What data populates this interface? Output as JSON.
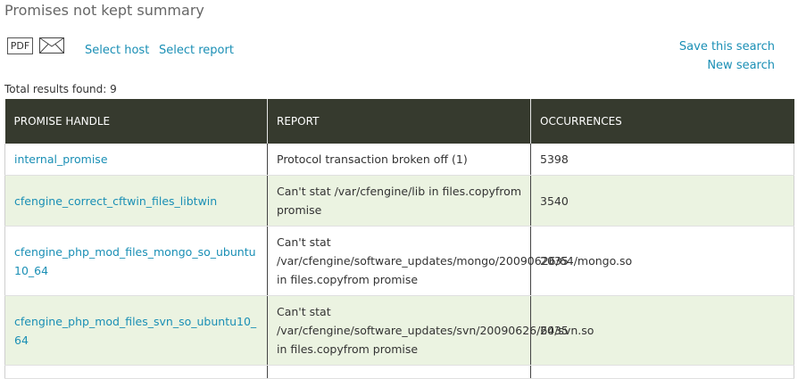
{
  "page": {
    "title": "Promises not kept summary"
  },
  "toolbar": {
    "pdf_label": "PDF",
    "select_host": "Select host",
    "select_report": "Select report",
    "save_search": "Save this search",
    "new_search": "New search"
  },
  "results": {
    "count_text": "Total results found: 9",
    "headers": [
      "PROMISE HANDLE",
      "REPORT",
      "OCCURRENCES"
    ],
    "rows": [
      {
        "handle": "internal_promise",
        "report": "Protocol transaction broken off (1)",
        "occurrences": "5398"
      },
      {
        "handle": "cfengine_correct_cftwin_files_libtwin",
        "report": "Can't stat /var/cfengine/lib in files.copyfrom promise",
        "occurrences": "3540"
      },
      {
        "handle": "cfengine_php_mod_files_mongo_so_ubuntu10_64",
        "report": "Can't stat /var/cfengine/software_updates/mongo/20090626/64/mongo.so in files.copyfrom promise",
        "occurrences": "2035"
      },
      {
        "handle": "cfengine_php_mod_files_svn_so_ubuntu10_64",
        "report": "Can't stat /var/cfengine/software_updates/svn/20090626/64/svn.so in files.copyfrom promise",
        "occurrences": "2035"
      },
      {
        "handle": "",
        "report": "",
        "occurrences": ""
      }
    ]
  }
}
